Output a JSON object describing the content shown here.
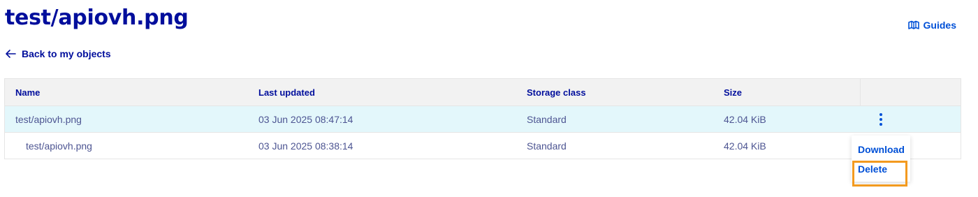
{
  "page": {
    "title": "test/apiovh.png"
  },
  "header_links": {
    "guides_label": "Guides",
    "back_label": "Back to my objects"
  },
  "table": {
    "columns": [
      "Name",
      "Last updated",
      "Storage class",
      "Size"
    ],
    "rows": [
      {
        "name": "test/apiovh.png",
        "last_updated": "03 Jun 2025 08:47:14",
        "storage_class": "Standard",
        "size": "42.04 KiB"
      },
      {
        "name": "test/apiovh.png",
        "last_updated": "03 Jun 2025 08:38:14",
        "storage_class": "Standard",
        "size": "42.04 KiB"
      }
    ]
  },
  "action_menu": {
    "items": [
      "Download",
      "Delete"
    ]
  },
  "icons": {
    "guides": "book-map-icon",
    "back": "arrow-left-icon",
    "actions": "kebab-menu-icon"
  },
  "colors": {
    "primary": "#000e9c",
    "link": "#0050d7",
    "row_selected": "#e3f7fb",
    "highlight": "#f39a1f"
  }
}
